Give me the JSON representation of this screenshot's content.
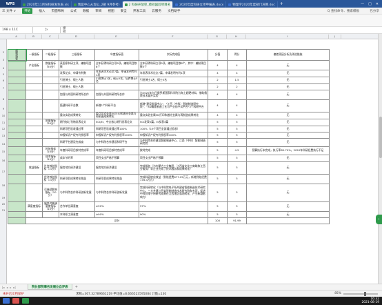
{
  "window": {
    "logo": "WPS",
    "tabs": [
      {
        "label": "2020年11月份科研发生表.xls",
        "color": "#3b9a4b"
      },
      {
        "label": "我是中心从现公_2部  9月参考)",
        "color": "#3b9a4b"
      },
      {
        "label": "2 科研开放空_绩效国验项目名",
        "color": "#3b9a4b",
        "active": true
      },
      {
        "label": "2020年度科研立项申报表.docx",
        "color": "#3a6fd1"
      },
      {
        "label": "物理学2020年度部门决算.doc",
        "color": "#3a6fd1"
      }
    ],
    "tab_add": "+"
  },
  "menu": {
    "file": "三 文件 ∨",
    "start": "开始",
    "items": [
      "插入",
      "页面布局",
      "公式",
      "数据",
      "审阅",
      "视图",
      "安全",
      "开发工具",
      "云服务",
      "文档助手"
    ],
    "search": "Q 查找命令、搜索模板",
    "share": "已分享"
  },
  "formula_bar": {
    "name_box": "198 x 11C",
    "fx": "ƒx",
    "content": [
      "绩",
      "效",
      "指",
      "标"
    ]
  },
  "columns": [
    "A",
    "B",
    "C",
    "D",
    "E",
    "F",
    "G",
    "H",
    "I",
    "J"
  ],
  "table": {
    "headers": [
      "一级指标",
      "二级指标",
      "三级指标",
      "年度指标值",
      "实际完成值",
      "分值",
      "得分",
      "偏差原因分析及改进措施"
    ],
    "section_label": "绩效指标",
    "rows": [
      {
        "l1": "产出指标",
        "l2": "数量指标（50分）",
        "l3": "获国家科研立项、编制项目数",
        "plan": "全年获得科研立项5项，编制项目数8个",
        "actual": "全年获得科研立项5项，编制项目数8个，其中：编制项目数5个",
        "score": "4",
        "got": "4",
        "note": "无"
      },
      {
        "l1": "",
        "l2": "",
        "l3": "发表论文、申请专利数",
        "plan": "年发表学术论文7篇，申请发明专利1项",
        "actual": "年发表学术论文7篇，申请发明专利1项",
        "score": "4",
        "got": "4",
        "note": "无"
      },
      {
        "l1": "",
        "l2": "",
        "l3": "引进博士、硕士人数",
        "plan": "引进博士1名，硕士5名，培养博士5名",
        "actual": "引进博士1名、硕士3名",
        "score": "2",
        "got": "1.5",
        "note": "无"
      },
      {
        "l1": "",
        "l2": "",
        "l3": "引进博士、硕士人数",
        "plan": "",
        "actual": "",
        "score": "2",
        "got": "2",
        "note": "无"
      },
      {
        "l1": "",
        "l2": "",
        "l3": "加强与外国科研院所合作",
        "plan": "加强与外国科研院所合作",
        "actual": "与2020年与日俄罗斯国家科学院为海上超硬材料，借助俄院技术展开实验",
        "score": "4",
        "got": "4",
        "note": "无"
      },
      {
        "l1": "",
        "l2": "",
        "l3": "搭建科研平台数",
        "plan": "新增1个科研平台",
        "actual": "新增\"建设发展中心\"、\"江西（中科）智能制造研究院\"、\"3D精准制造工艺与产业化中试平台\"3个科研平台",
        "score": "4",
        "got": "4",
        "note": "无"
      },
      {
        "l1": "",
        "l2": "",
        "l3": "重点实验成果转化",
        "plan": "重点实验金属3D打印和激光金属与再制造成果转化",
        "actual": "重点实验金属3D打印和激光金属与再制造成果转化",
        "score": "4",
        "got": "4",
        "note": "无"
      },
      {
        "l1": "",
        "l2": "质量指标（30分）",
        "l3": "期刊核心刊物发表论文",
        "plan": "SCI/EI、中文核心期刊发表论文",
        "actual": "SCI发表5篇，EI发表3篇",
        "score": "5",
        "got": "5",
        "note": "无"
      },
      {
        "l1": "",
        "l2": "",
        "l3": "科研项目验收通过率",
        "plan": "科研项目验收通过率100%",
        "actual": "100%（19个项目全部通过验收）",
        "score": "5",
        "got": "5",
        "note": "无"
      },
      {
        "l1": "",
        "l2": "",
        "l3": "申报知识产权专利授权率",
        "plan": "申报知识产权专利授权率100%",
        "actual": "申报知识产权专利授权率100%",
        "score": "5",
        "got": "5",
        "note": "无"
      },
      {
        "l1": "",
        "l2": "",
        "l3": "科研平台建设完成度",
        "plan": "与中科院合作建设科研平台",
        "actual": "与中科院合作建设智能制造中心、江西（中科）智能制造研究院",
        "score": "5",
        "got": "5",
        "note": "无"
      },
      {
        "l1": "",
        "l2": "时效指标（10分）",
        "l3": "年度科研项目按时完成率",
        "plan": "年度科研项目按时完成率",
        "actual": "按时完成",
        "score": "5",
        "got": "4.5",
        "note": "预算执行未完成，执行率85.79%，2020年科研经费执行不足"
      },
      {
        "l1": "",
        "l2": "成本指标（10分）",
        "l3": "成本节约率",
        "plan": "项目支出严格于预算",
        "actual": "项目支出严格于预算",
        "score": "5",
        "got": "5",
        "note": "无"
      },
      {
        "l1": "效益指标",
        "l2": "社会效益指标（10分）",
        "l3": "服务地方经济建设",
        "plan": "服务地方经济建设",
        "actual": "完成服务（为内蒙古工业集团、江西省文化工商联和江西分服务厂等企业完成了技术服务和成果转化）",
        "score": "5",
        "got": "5",
        "note": "无"
      },
      {
        "l1": "",
        "l2": "经济效益指标（10分）",
        "l3": "科研项目成果转化效益",
        "plan": "科研项目成果转化效益",
        "actual": "完成科研转化效益（到账经费677.25万元，新增到账经费178.4万元）",
        "score": "5",
        "got": "5",
        "note": "无"
      },
      {
        "l1": "",
        "l2": "可持续影响指标（10分）",
        "l3": "与中科院合作科研创新发展",
        "plan": "与中科院合作科研创新发展",
        "actual": "完成科研转化（与中科院电子所共建省智能制造技术研究中心，三方共建江西省智能制造技术研究院和专项，促进中科院电子所研究成果在江西地区落地转化、产生新颖影响力）",
        "score": "5",
        "got": "5",
        "note": "无"
      },
      {
        "l1": "满意度指标",
        "l2": "服务对象满意度指标（10分）",
        "l3": "合作单位满意度",
        "plan": "≥90%",
        "actual": "97%",
        "score": "5",
        "got": "5",
        "note": "无"
      },
      {
        "l1": "",
        "l2": "",
        "l3": "本科职工满意度",
        "plan": "≥90%",
        "actual": "90%",
        "score": "5",
        "got": "5",
        "note": "无"
      }
    ],
    "total_label": "总分",
    "total_score": "100",
    "total_got": "91.99"
  },
  "sheet_tabs": [
    "院长部院事务发展业自评表"
  ],
  "status": {
    "protect": "未开启文档保护",
    "stats": "求和=367.32789661219  平均值=8.666523595084  计数=130",
    "zoom": "85%"
  },
  "taskbar": {
    "time": "16:32",
    "date": "2021-08-19"
  },
  "colors": {
    "tab_bar": "#2b579a",
    "accent_green": "#2e9a4b",
    "selected_col": "#c8e6c9"
  }
}
